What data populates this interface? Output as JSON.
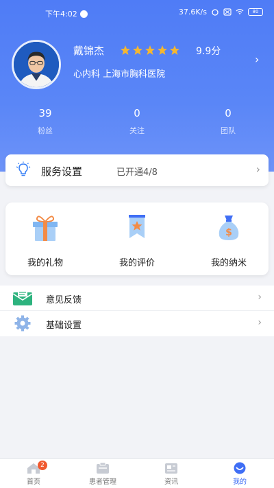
{
  "status_bar": {
    "time": "下午4:02",
    "network": "37.6K/s",
    "battery": "80"
  },
  "profile": {
    "name": "戴锦杰",
    "rating_stars": 5,
    "score": "9.9分",
    "department": "心内科 上海市胸科医院"
  },
  "stats": [
    {
      "value": "39",
      "label": "粉丝"
    },
    {
      "value": "0",
      "label": "关注"
    },
    {
      "value": "0",
      "label": "团队"
    }
  ],
  "service": {
    "title": "服务设置",
    "status": "已开通4/8"
  },
  "quick_actions": [
    {
      "label": "我的礼物",
      "icon": "gift-icon"
    },
    {
      "label": "我的评价",
      "icon": "review-bookmark-icon"
    },
    {
      "label": "我的纳米",
      "icon": "money-bag-icon"
    }
  ],
  "menu": [
    {
      "label": "意见反馈",
      "icon": "feedback-envelope-icon"
    },
    {
      "label": "基础设置",
      "icon": "gear-icon"
    }
  ],
  "tabs": [
    {
      "label": "首页",
      "badge": "2",
      "icon": "home-icon"
    },
    {
      "label": "患者管理",
      "icon": "patients-icon"
    },
    {
      "label": "资讯",
      "icon": "news-icon"
    },
    {
      "label": "我的",
      "icon": "profile-icon",
      "active": true
    }
  ],
  "colors": {
    "accent": "#3f6ef5",
    "header": "#5a86f7",
    "star": "#f5b731",
    "badge": "#f05a30"
  }
}
